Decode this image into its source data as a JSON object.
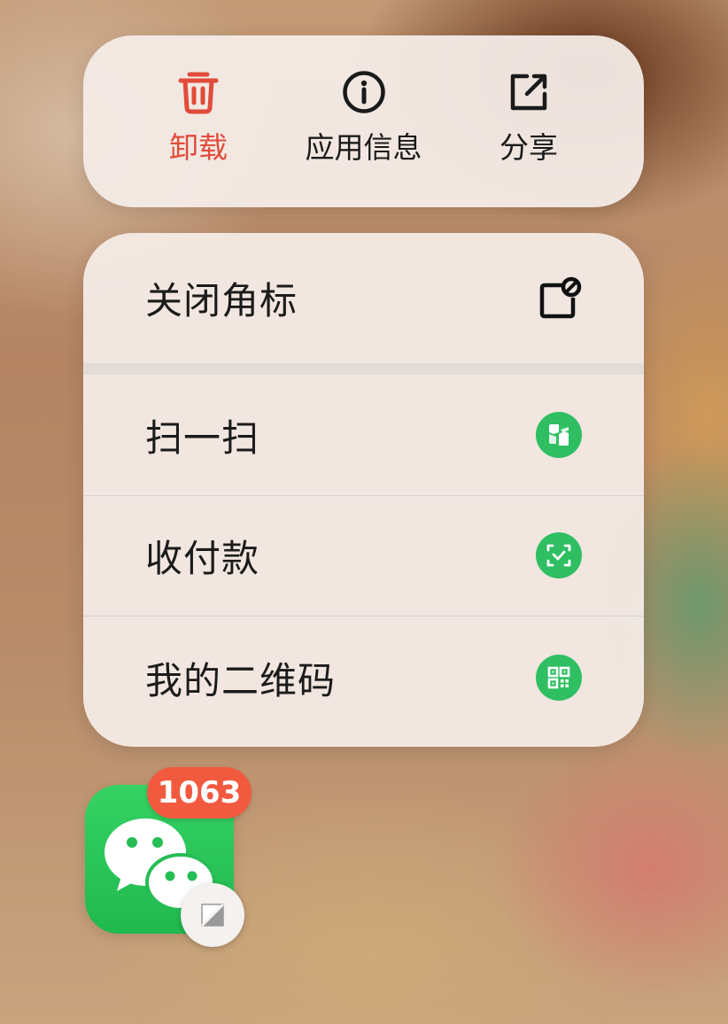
{
  "quick_actions": {
    "uninstall": {
      "label": "卸载",
      "icon": "trash-icon",
      "color": "#e14b3b"
    },
    "app_info": {
      "label": "应用信息",
      "icon": "info-icon"
    },
    "share": {
      "label": "分享",
      "icon": "share-icon"
    }
  },
  "menu": {
    "items": [
      {
        "label": "关闭角标",
        "icon": "badge-off-icon"
      },
      {
        "label": "扫一扫",
        "icon": "scan-icon"
      },
      {
        "label": "收付款",
        "icon": "payment-icon"
      },
      {
        "label": "我的二维码",
        "icon": "qr-code-icon"
      }
    ]
  },
  "app": {
    "icon": "wechat-icon",
    "badge_count": "1063",
    "edit_badge_icon": "edit-icon"
  },
  "colors": {
    "accent_green": "#2fbf62",
    "danger_red": "#e14b3b",
    "badge_red": "#f25a3f"
  }
}
